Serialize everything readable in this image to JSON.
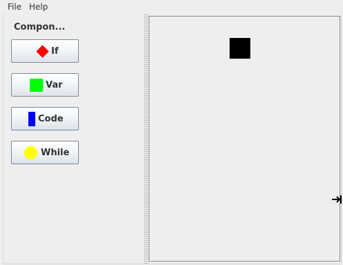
{
  "menubar": {
    "items": [
      {
        "label": "File"
      },
      {
        "label": "Help"
      }
    ]
  },
  "palette": {
    "title": "Compon...",
    "buttons": [
      {
        "label": "If",
        "icon": "red-diamond-icon",
        "color": "#ff0000"
      },
      {
        "label": "Var",
        "icon": "green-square-icon",
        "color": "#00ff00"
      },
      {
        "label": "Code",
        "icon": "blue-rect-icon",
        "color": "#0000ff"
      },
      {
        "label": "While",
        "icon": "yellow-circle-icon",
        "color": "#ffff00"
      }
    ]
  },
  "canvas": {
    "blocks": [
      {
        "shape": "black-square",
        "color": "#000000"
      }
    ]
  }
}
